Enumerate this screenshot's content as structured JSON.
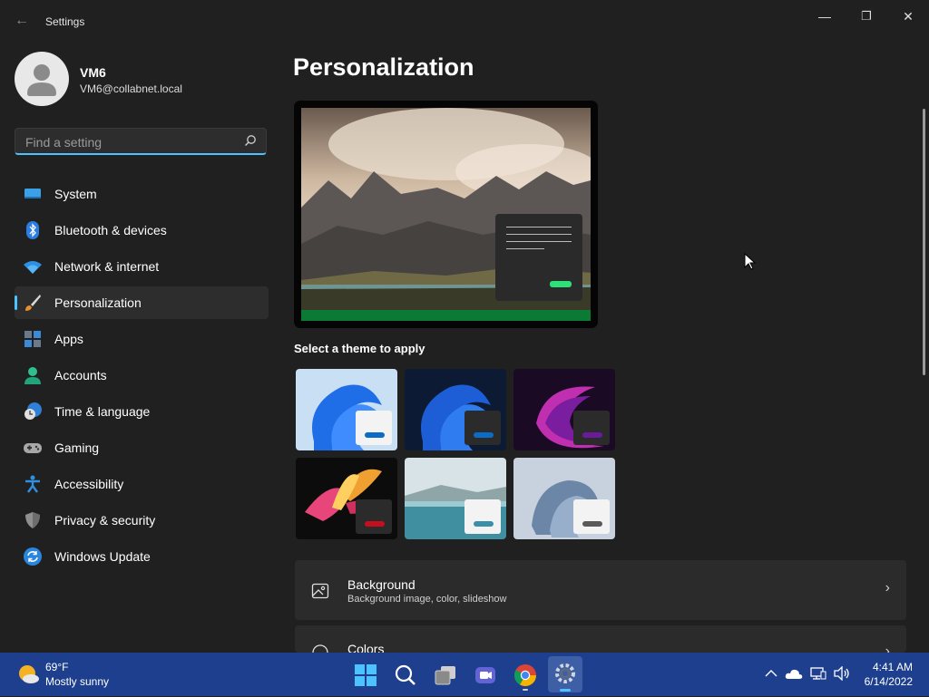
{
  "window": {
    "title": "Settings",
    "minimize_glyph": "—",
    "maximize_glyph": "❐",
    "close_glyph": "✕"
  },
  "profile": {
    "name": "VM6",
    "email": "VM6@collabnet.local"
  },
  "search": {
    "placeholder": "Find a setting",
    "value": ""
  },
  "sidebar": {
    "items": [
      {
        "label": "System",
        "icon": "system-icon",
        "selected": false
      },
      {
        "label": "Bluetooth & devices",
        "icon": "bluetooth-icon",
        "selected": false
      },
      {
        "label": "Network & internet",
        "icon": "wifi-icon",
        "selected": false
      },
      {
        "label": "Personalization",
        "icon": "brush-icon",
        "selected": true
      },
      {
        "label": "Apps",
        "icon": "apps-icon",
        "selected": false
      },
      {
        "label": "Accounts",
        "icon": "accounts-icon",
        "selected": false
      },
      {
        "label": "Time & language",
        "icon": "clock-globe-icon",
        "selected": false
      },
      {
        "label": "Gaming",
        "icon": "gamepad-icon",
        "selected": false
      },
      {
        "label": "Accessibility",
        "icon": "accessibility-icon",
        "selected": false
      },
      {
        "label": "Privacy & security",
        "icon": "shield-icon",
        "selected": false
      },
      {
        "label": "Windows Update",
        "icon": "update-icon",
        "selected": false
      }
    ]
  },
  "main": {
    "title": "Personalization",
    "themes_label": "Select a theme to apply",
    "themes": [
      {
        "name": "windows-light",
        "accent": "#0a6cc4"
      },
      {
        "name": "windows-dark",
        "accent": "#0a6cc4"
      },
      {
        "name": "glow",
        "accent": "#6a1b9a"
      },
      {
        "name": "captured-motion",
        "accent": "#c50f1f"
      },
      {
        "name": "sunrise-lake",
        "accent": "#3c8fa8"
      },
      {
        "name": "flow",
        "accent": "#5a5a5a"
      }
    ],
    "cards": [
      {
        "title": "Background",
        "subtitle": "Background image, color, slideshow",
        "icon": "image-icon"
      },
      {
        "title": "Colors",
        "subtitle": "",
        "icon": "palette-icon"
      }
    ]
  },
  "taskbar": {
    "weather_temp": "69°F",
    "weather_desc": "Mostly sunny",
    "time": "4:41 AM",
    "date": "6/14/2022"
  },
  "colors": {
    "accent": "#4cc2ff",
    "bg": "#202020",
    "taskbar": "#1d3f8e"
  }
}
